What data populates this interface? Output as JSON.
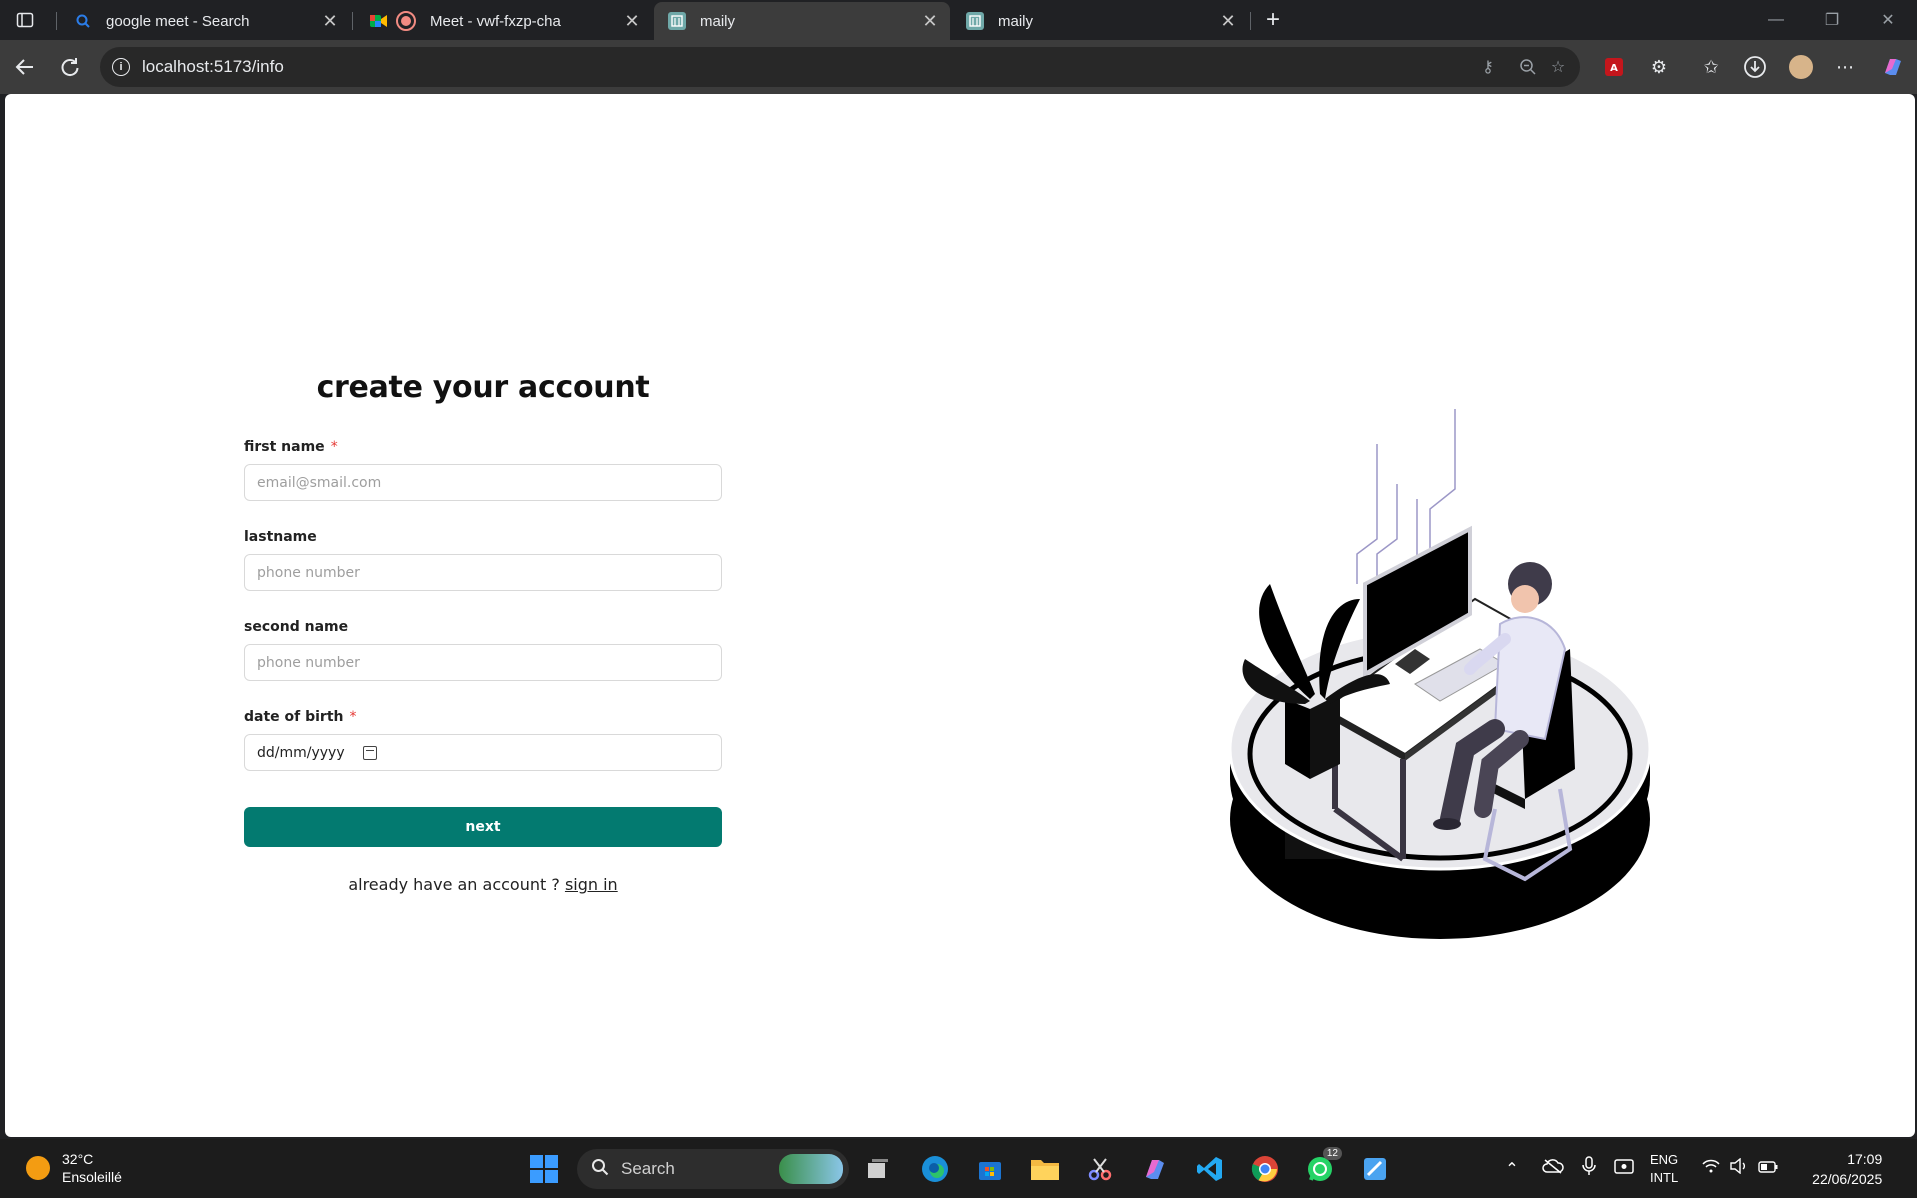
{
  "browser": {
    "tabs": [
      {
        "title": "google meet - Search",
        "icon": "search-favicon"
      },
      {
        "title": "Meet - vwf-fxzp-cha",
        "icon": "meet-favicon"
      },
      {
        "title": "maily",
        "icon": "maily-favicon",
        "active": true
      },
      {
        "title": "maily",
        "icon": "maily-favicon"
      }
    ],
    "url": "localhost:5173/info"
  },
  "form": {
    "title": "create your account",
    "fields": [
      {
        "label": "first name",
        "required": true,
        "placeholder": "email@smail.com"
      },
      {
        "label": "lastname",
        "required": false,
        "placeholder": "phone number"
      },
      {
        "label": "second name",
        "required": false,
        "placeholder": "phone number"
      },
      {
        "label": "date of birth",
        "required": true,
        "placeholder": "dd/mm/yyyy"
      }
    ],
    "required_mark": "*",
    "next_label": "next",
    "signin_prompt": "already have an account ?",
    "signin_link": "sign in"
  },
  "taskbar": {
    "weather_temp": "32°C",
    "weather_desc": "Ensoleillé",
    "search_label": "Search",
    "lang_top": "ENG",
    "lang_bottom": "INTL",
    "time": "17:09",
    "date": "22/06/2025",
    "whatsapp_badge": "12"
  },
  "colors": {
    "accent": "#037a70",
    "required": "#e53935"
  }
}
